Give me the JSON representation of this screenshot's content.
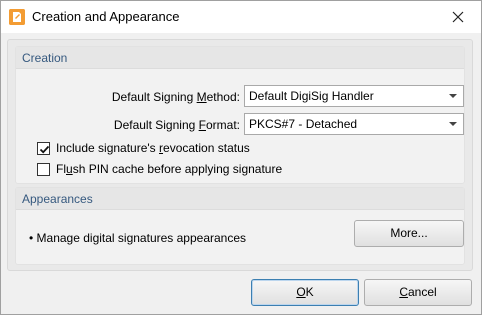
{
  "window": {
    "title": "Creation and Appearance",
    "icon": "app-logo-icon",
    "close_icon": "close-icon"
  },
  "creation": {
    "header": "Creation",
    "signing_method": {
      "label_pre": "Default Signing ",
      "label_accel": "M",
      "label_post": "ethod:",
      "value": "Default DigiSig Handler"
    },
    "signing_format": {
      "label_pre": "Default Signing ",
      "label_accel": "F",
      "label_post": "ormat:",
      "value": "PKCS#7 - Detached"
    },
    "include_revocation": {
      "checked": true,
      "label_pre": "Include signature's ",
      "label_accel": "r",
      "label_post": "evocation status"
    },
    "flush_pin": {
      "checked": false,
      "label_pre": "Fl",
      "label_accel": "u",
      "label_post": "sh PIN cache before applying signature"
    }
  },
  "appearances": {
    "header": "Appearances",
    "manage_text": "• Manage digital signatures appearances",
    "more_button": "More..."
  },
  "footer": {
    "ok_accel": "O",
    "ok_rest": "K",
    "cancel_accel": "C",
    "cancel_rest": "ancel"
  }
}
